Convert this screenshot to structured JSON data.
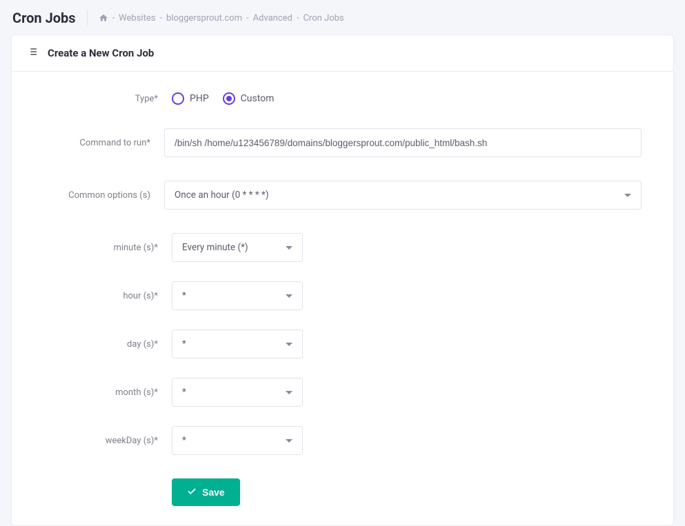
{
  "header": {
    "title": "Cron Jobs",
    "breadcrumb": {
      "p1": "Websites",
      "p2": "bloggersprout.com",
      "p3": "Advanced",
      "p4": "Cron Jobs"
    }
  },
  "card": {
    "title": "Create a New Cron Job"
  },
  "form": {
    "type_label": "Type*",
    "type_options": {
      "php": "PHP",
      "custom": "Custom"
    },
    "command_label": "Command to run*",
    "command_value": "/bin/sh /home/u123456789/domains/bloggersprout.com/public_html/bash.sh",
    "common_label": "Common options (s)",
    "common_value": "Once an hour (0 * * * *)",
    "minute_label": "minute (s)*",
    "minute_value": "Every minute (*)",
    "hour_label": "hour (s)*",
    "hour_value": "*",
    "day_label": "day (s)*",
    "day_value": "*",
    "month_label": "month (s)*",
    "month_value": "*",
    "weekday_label": "weekDay (s)*",
    "weekday_value": "*",
    "save_label": "Save"
  }
}
